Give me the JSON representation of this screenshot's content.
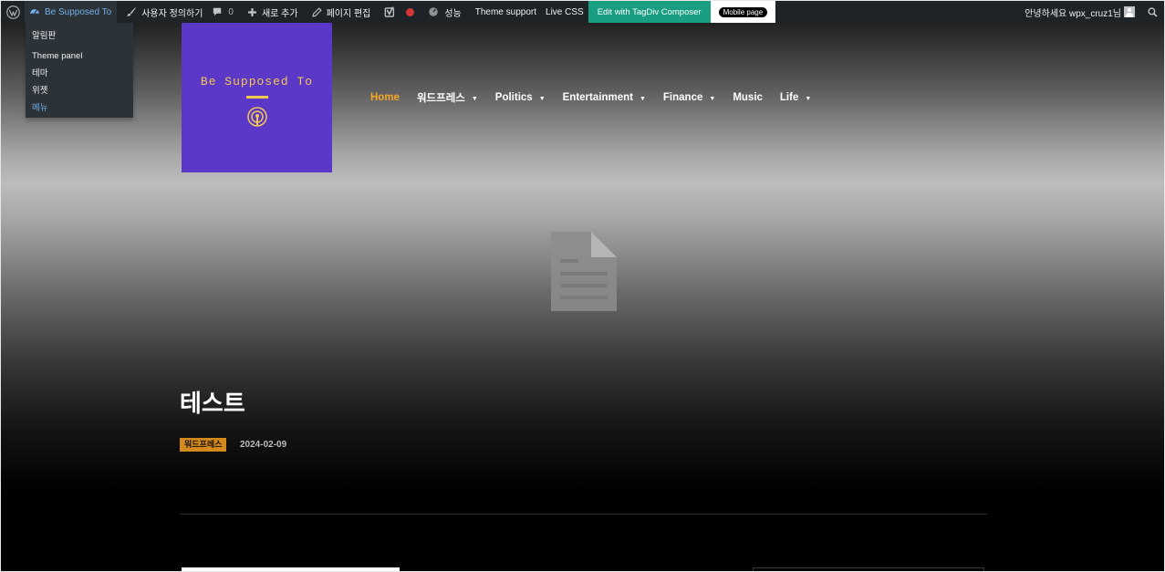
{
  "adminbar": {
    "site_name": "Be Supposed To",
    "customize": "사용자 정의하기",
    "comments_count": "0",
    "new_content": "새로 추가",
    "edit_page": "페이지 편집",
    "performance": "성능",
    "theme_support": "Theme support",
    "live_css": "Live CSS",
    "tagdiv": "Edit with TagDiv Composer",
    "mobile_page": "Mobile page",
    "greeting": "안녕하세요 wpx_cruz1님"
  },
  "site_menu": {
    "items": [
      {
        "label": "알림판"
      },
      {
        "label": "Theme panel"
      },
      {
        "label": "테마"
      },
      {
        "label": "위젯"
      },
      {
        "label": "메뉴"
      }
    ]
  },
  "logo": {
    "text": "Be Supposed To"
  },
  "nav": {
    "items": [
      {
        "label": "Home"
      },
      {
        "label": "워드프레스"
      },
      {
        "label": "Politics"
      },
      {
        "label": "Entertainment"
      },
      {
        "label": "Finance"
      },
      {
        "label": "Music"
      },
      {
        "label": "Life"
      }
    ]
  },
  "post": {
    "title": "테스트",
    "category": "워드프레스",
    "date": "2024-02-09"
  },
  "colors": {
    "adminbar_bg": "#1d2327",
    "adminbar_link": "#72aee6",
    "tagdiv_green": "#199e82",
    "logo_bg": "#5b38c7",
    "logo_accent": "#f2c94c",
    "nav_active": "#f5a623",
    "category_badge": "#d4891c"
  },
  "icons": [
    "wordpress-logo-icon",
    "dashboard-icon",
    "brush-icon",
    "comment-icon",
    "plus-icon",
    "pencil-icon",
    "yoast-icon",
    "status-dot-icon",
    "performance-icon",
    "avatar-icon",
    "search-icon",
    "podcast-icon",
    "document-placeholder-icon",
    "dropdown-caret-icon"
  ]
}
